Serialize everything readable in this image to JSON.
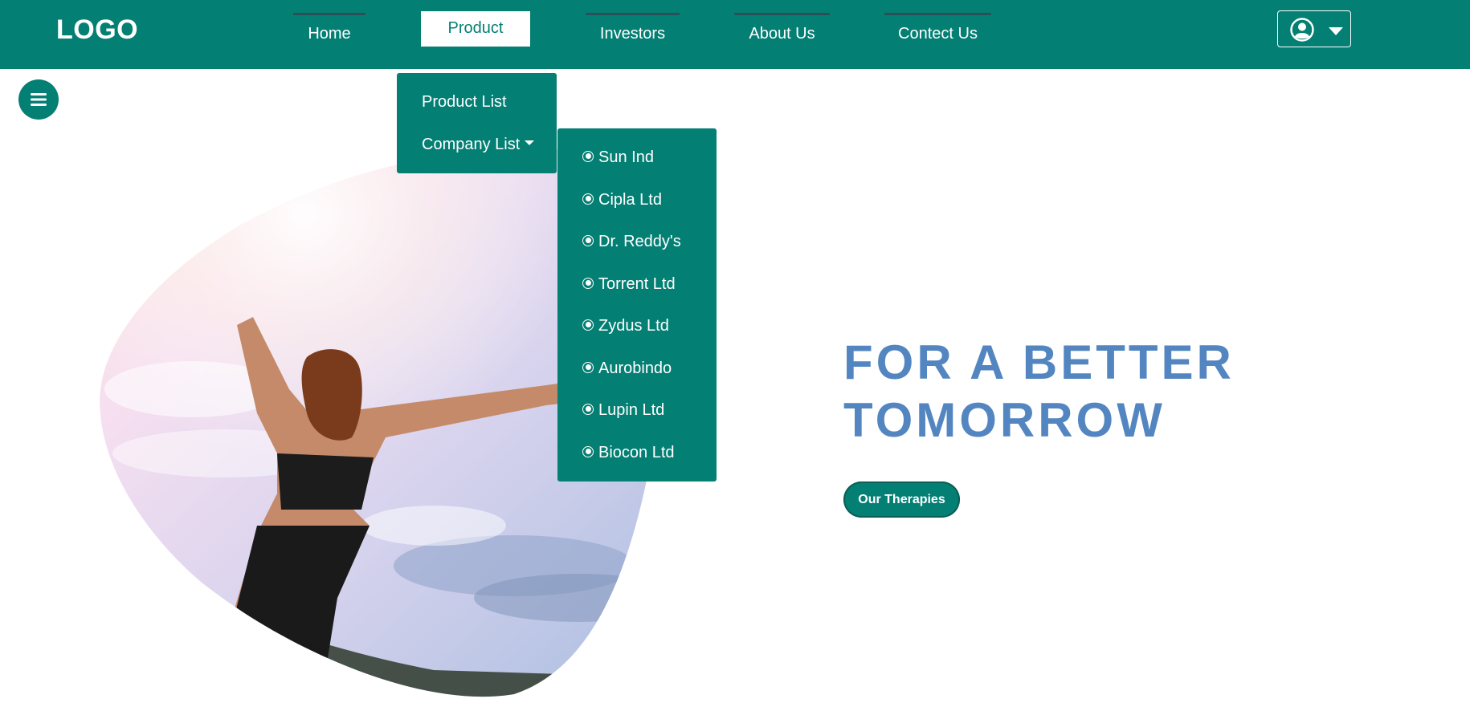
{
  "header": {
    "logo": "LOGO",
    "nav": [
      {
        "label": "Home"
      },
      {
        "label": "Product",
        "active": true
      },
      {
        "label": "Investors"
      },
      {
        "label": "About Us"
      },
      {
        "label": "Contect Us"
      }
    ],
    "profile": {
      "icon": "user-circle-icon",
      "caret": "caret-down-icon"
    }
  },
  "menu_button": {
    "icon": "hamburger-icon"
  },
  "product_dropdown": {
    "items": [
      {
        "label": "Product List"
      },
      {
        "label": "Company List",
        "has_submenu": true
      }
    ]
  },
  "company_submenu": {
    "items": [
      {
        "label": "Sun Ind"
      },
      {
        "label": "Cipla Ltd"
      },
      {
        "label": "Dr. Reddy's"
      },
      {
        "label": "Torrent Ltd"
      },
      {
        "label": "Zydus Ltd"
      },
      {
        "label": "Aurobindo"
      },
      {
        "label": "Lupin Ltd"
      },
      {
        "label": "Biocon Ltd"
      }
    ]
  },
  "hero": {
    "headline_line1": "FOR A BETTER",
    "headline_line2": "TOMORROW",
    "cta_label": "Our Therapies"
  },
  "colors": {
    "brand": "#047f74",
    "headline": "#5386c0",
    "background": "#ffffff"
  }
}
